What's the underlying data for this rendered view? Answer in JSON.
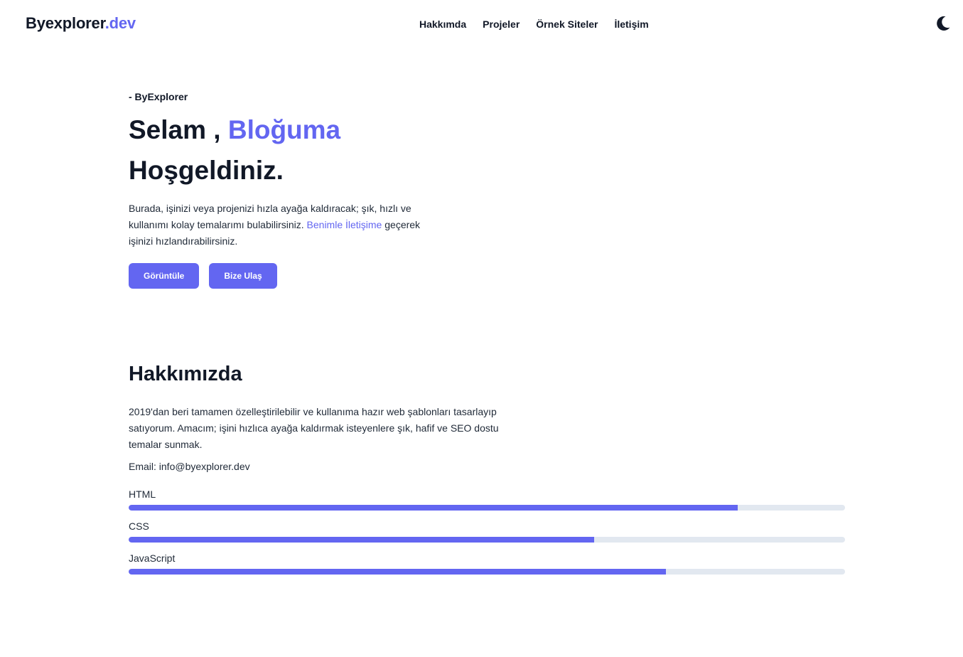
{
  "header": {
    "logo_main": "Byexplorer",
    "logo_accent": ".dev",
    "nav": [
      {
        "label": "Hakkımda"
      },
      {
        "label": "Projeler"
      },
      {
        "label": "Örnek Siteler"
      },
      {
        "label": "İletişim"
      }
    ],
    "theme_icon": "moon-icon"
  },
  "hero": {
    "eyebrow": "- ByExplorer",
    "title_part1": "Selam , ",
    "title_accent": "Bloğuma",
    "title_line2": "Hoşgeldiniz.",
    "text_before_link": "Burada, işinizi veya projenizi hızla ayağa kaldıracak; şık, hızlı ve kullanımı kolay temalarımı bulabilirsiniz. ",
    "text_link": "Benimle İletişime",
    "text_after_link": " geçerek işinizi hızlandırabilirsiniz.",
    "buttons": {
      "primary": "Görüntüle",
      "secondary": "Bize Ulaş"
    }
  },
  "about": {
    "title": "Hakkımızda",
    "text": "2019'dan beri tamamen özelleştirilebilir ve kullanıma hazır web şablonları tasarlayıp satıyorum. Amacım; işini hızlıca ayağa kaldırmak isteyenlere şık, hafif ve SEO dostu temalar sunmak.",
    "email": "Email: info@byexplorer.dev",
    "skills": [
      {
        "label": "HTML",
        "percent": 85
      },
      {
        "label": "CSS",
        "percent": 65
      },
      {
        "label": "JavaScript",
        "percent": 75
      }
    ]
  },
  "colors": {
    "accent": "#6366f1",
    "text": "#111827",
    "track": "#e2e8f0"
  }
}
